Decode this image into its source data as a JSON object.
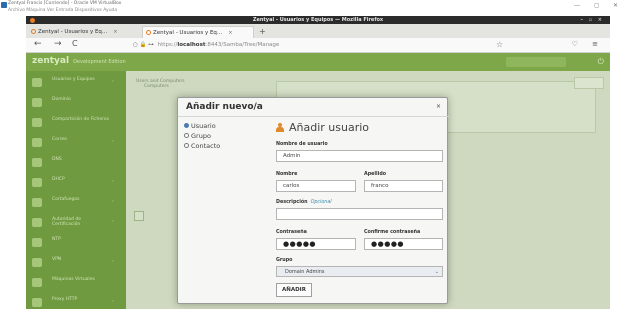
{
  "host": {
    "window_title": "Zentyal Francis [Corriendo] - Oracle VM VirtualBox",
    "menu": "Archivo  Máquina  Ver  Entrada  Dispositivos  Ayuda",
    "controls": "— ◻ ✕"
  },
  "guest": {
    "titlebar": "Zentyal - Usuarios y Equipos — Mozilla Firefox",
    "titlebar_controls": "– ▫ ×"
  },
  "browser": {
    "tabs": [
      {
        "label": "Zentyal - Usuarios y Eq…",
        "close": "×"
      },
      {
        "label": "Zentyal - Usuarios y Eq…",
        "close": "×"
      }
    ],
    "new_tab": "+",
    "back": "←",
    "forward": "→",
    "reload": "C",
    "url_icons": "○ 🔒 ⊶",
    "url_prefix": "https://",
    "url_host": "localhost",
    "url_rest": ":8443/Samba/Tree/Manage",
    "bookmark_star": "☆",
    "right_icons": "♡ ≡"
  },
  "app": {
    "logo": "zentyal",
    "subtitle": "Development Edition",
    "logout": "⏻",
    "sidebar": [
      {
        "label": "Usuarios y Equipos",
        "arrow": "›"
      },
      {
        "label": "Dominio",
        "arrow": ""
      },
      {
        "label": "Compartición de Ficheros",
        "arrow": ""
      },
      {
        "label": "Correo",
        "arrow": "›"
      },
      {
        "label": "DNS",
        "arrow": ""
      },
      {
        "label": "DHCP",
        "arrow": "›"
      },
      {
        "label": "Cortafuegos",
        "arrow": "›"
      },
      {
        "label": "Autoridad de Certificación",
        "arrow": "›"
      },
      {
        "label": "NTP",
        "arrow": ""
      },
      {
        "label": "VPN",
        "arrow": "›"
      },
      {
        "label": "Máquinas Virtuales",
        "arrow": ""
      },
      {
        "label": "Proxy HTTP",
        "arrow": "›"
      }
    ],
    "tree_root": "Users and Computers",
    "tree_child": "Computers"
  },
  "modal": {
    "title": "Añadir nuevo/a",
    "close": "×",
    "types": [
      {
        "label": "Usuario",
        "checked": true
      },
      {
        "label": "Grupo",
        "checked": false
      },
      {
        "label": "Contacto",
        "checked": false
      }
    ],
    "form_title": "Añadir usuario",
    "username_label": "Nombre de usuario",
    "username_value": "Admin",
    "firstname_label": "Nombre",
    "firstname_value": "carlos",
    "lastname_label": "Apellido",
    "lastname_value": "franco",
    "description_label": "Descripción",
    "description_optional": "Opcional",
    "description_value": "",
    "password_label": "Contraseña",
    "password_value": "●●●●●",
    "confirm_label": "Confirme contraseña",
    "confirm_value": "●●●●●",
    "group_label": "Grupo",
    "group_value": "Domain Admins",
    "group_caret": "⌄",
    "submit": "AÑADIR"
  },
  "colors": {
    "accent_green": "#7ea74a",
    "sidebar_green": "#6f9a40",
    "user_icon": "#e08a2c"
  }
}
